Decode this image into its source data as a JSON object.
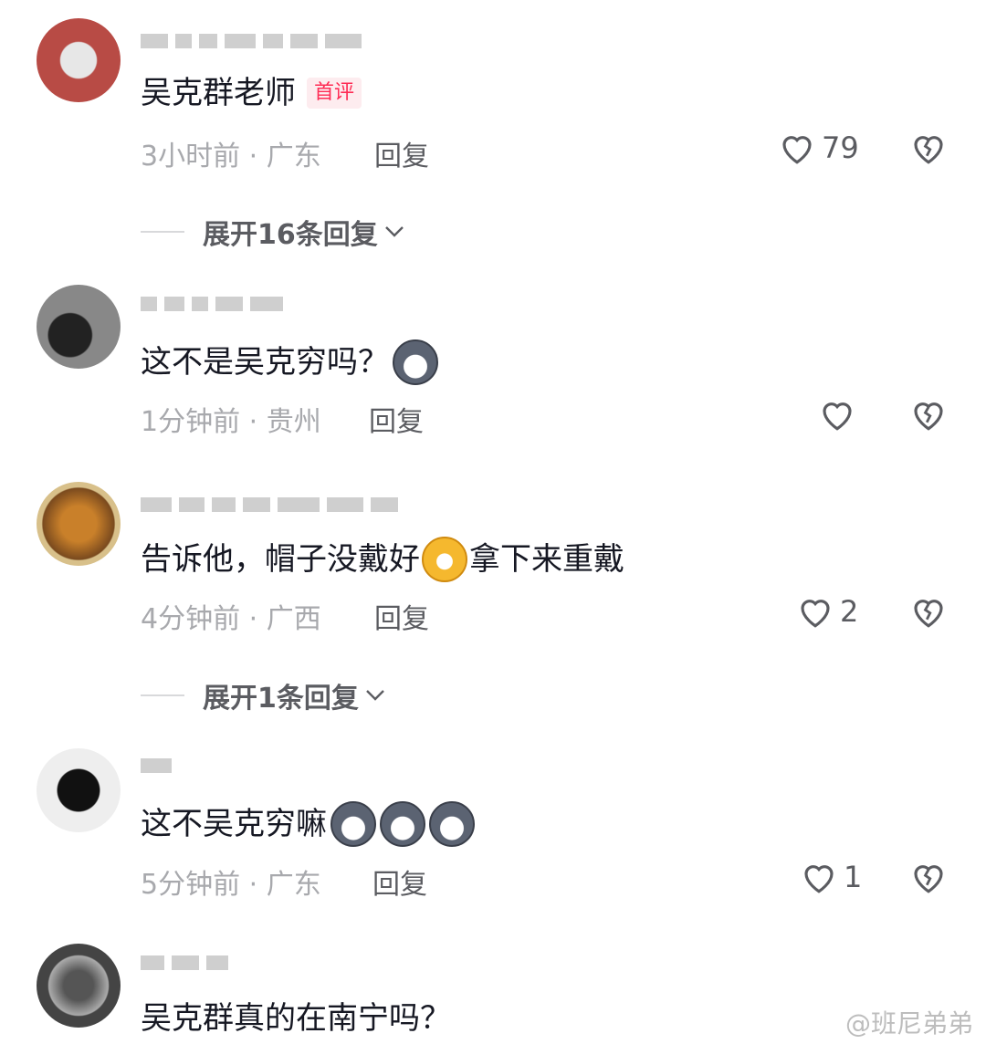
{
  "comments": [
    {
      "text": "吴克群老师",
      "badge": "首评",
      "meta": "3小时前 · 广东",
      "reply": "回复",
      "likes": "79",
      "expand": "展开16条回复"
    },
    {
      "text": "这不是吴克穷吗？",
      "meta": "1分钟前 · 贵州",
      "reply": "回复",
      "likes": ""
    },
    {
      "text_before": "告诉他，帽子没戴好",
      "text_after": "拿下来重戴",
      "meta": "4分钟前 · 广西",
      "reply": "回复",
      "likes": "2",
      "expand": "展开1条回复"
    },
    {
      "text": "这不吴克穷嘛",
      "meta": "5分钟前 · 广东",
      "reply": "回复",
      "likes": "1"
    },
    {
      "text": "吴克群真的在南宁吗？"
    }
  ],
  "watermark": "@班尼弟弟",
  "icons": {
    "like": "heart-outline-icon",
    "dislike": "broken-heart-icon",
    "expand": "chevron-down-icon",
    "emoji_dog": "husky-dog-emoji",
    "emoji_grin": "grinning-face-emoji"
  },
  "colors": {
    "badge_text": "#fe2c55",
    "badge_bg": "#fdecef",
    "meta": "#a8a9ad",
    "action": "#5b5c61"
  }
}
